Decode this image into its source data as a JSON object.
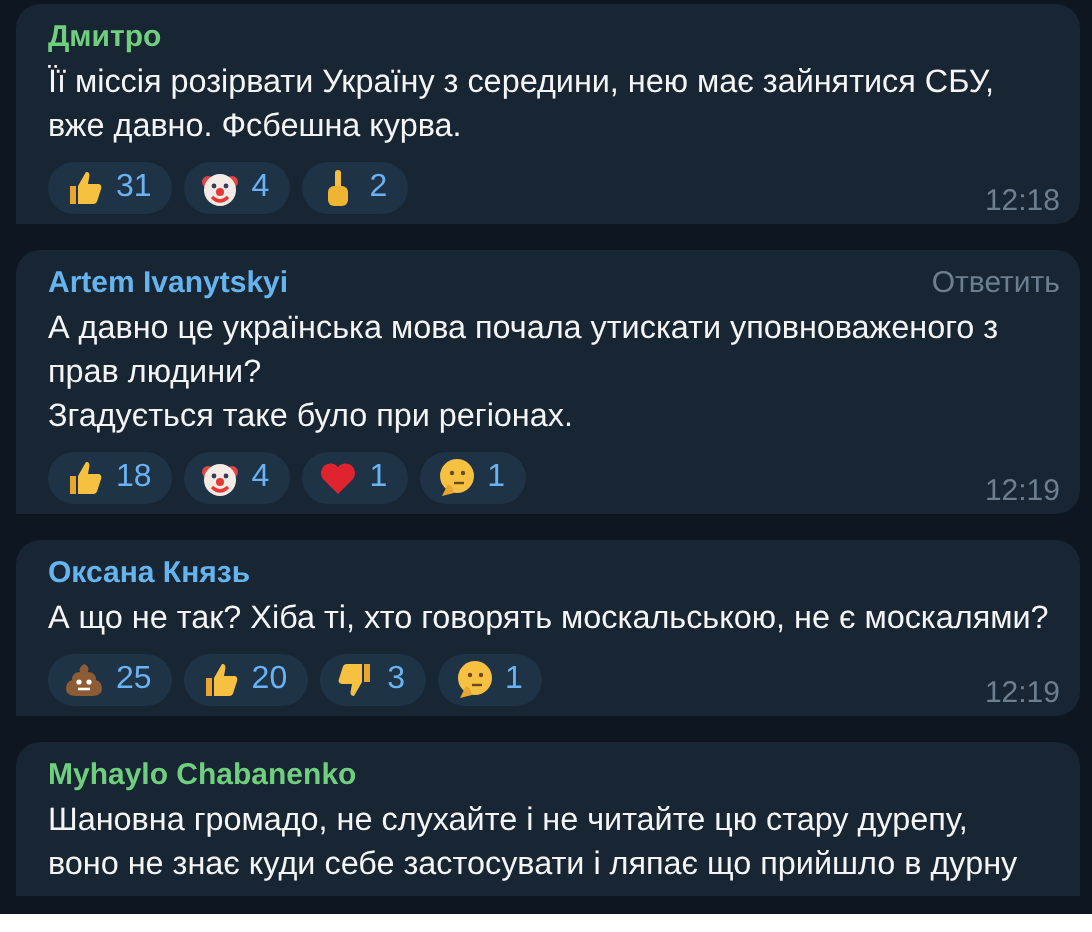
{
  "messages": [
    {
      "author": "Дмитро",
      "color": "#6fcf7f",
      "text": "Її міссія розірвати Україну з середини, нею має зайнятися СБУ,\nвже давно. Фсбешна курва.",
      "reactions": [
        {
          "kind": "thumbs-up",
          "count": "31"
        },
        {
          "kind": "clown",
          "count": "4"
        },
        {
          "kind": "finger",
          "count": "2"
        }
      ],
      "time": "12:18"
    },
    {
      "author": "Artem Ivanytskyi",
      "color": "#64b5ef",
      "reply": "Ответить",
      "text": "А давно це українська мова почала утискати уповноваженого з\nправ людини?\nЗгадується таке було при регіонах.",
      "reactions": [
        {
          "kind": "thumbs-up",
          "count": "18"
        },
        {
          "kind": "clown",
          "count": "4"
        },
        {
          "kind": "heart",
          "count": "1"
        },
        {
          "kind": "thinking",
          "count": "1"
        }
      ],
      "time": "12:19"
    },
    {
      "author": "Оксана Князь",
      "color": "#64b5ef",
      "text": "А що не так? Хіба ті, хто говорять москальською, не є москалями?",
      "reactions": [
        {
          "kind": "poop",
          "count": "25"
        },
        {
          "kind": "thumbs-up",
          "count": "20"
        },
        {
          "kind": "thumbs-down",
          "count": "3"
        },
        {
          "kind": "thinking",
          "count": "1"
        }
      ],
      "time": "12:19"
    },
    {
      "author": "Myhaylo Chabanenko",
      "color": "#6fcf7f",
      "text": "Шановна громадо, не слухайте і не читайте цю стару дурепу,\nвоно не знає куди себе застосувати і ляпає що прийшло в дурну"
    }
  ]
}
